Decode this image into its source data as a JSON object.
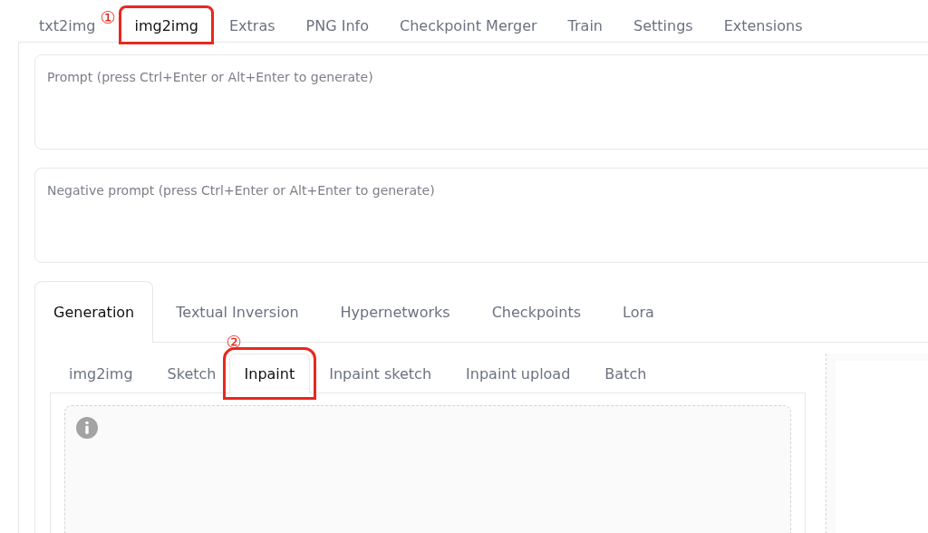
{
  "main_tabs": [
    {
      "label": "txt2img",
      "selected": false
    },
    {
      "label": "img2img",
      "selected": true,
      "callout": "①"
    },
    {
      "label": "Extras",
      "selected": false
    },
    {
      "label": "PNG Info",
      "selected": false
    },
    {
      "label": "Checkpoint Merger",
      "selected": false
    },
    {
      "label": "Train",
      "selected": false
    },
    {
      "label": "Settings",
      "selected": false
    },
    {
      "label": "Extensions",
      "selected": false
    }
  ],
  "prompt": {
    "placeholder": "Prompt (press Ctrl+Enter or Alt+Enter to generate)"
  },
  "negative_prompt": {
    "placeholder": "Negative prompt (press Ctrl+Enter or Alt+Enter to generate)"
  },
  "section_tabs": [
    {
      "label": "Generation",
      "selected": true
    },
    {
      "label": "Textual Inversion",
      "selected": false
    },
    {
      "label": "Hypernetworks",
      "selected": false
    },
    {
      "label": "Checkpoints",
      "selected": false
    },
    {
      "label": "Lora",
      "selected": false
    }
  ],
  "mode_tabs": [
    {
      "label": "img2img",
      "selected": false
    },
    {
      "label": "Sketch",
      "selected": false
    },
    {
      "label": "Inpaint",
      "selected": true,
      "callout": "②"
    },
    {
      "label": "Inpaint sketch",
      "selected": false
    },
    {
      "label": "Inpaint upload",
      "selected": false
    },
    {
      "label": "Batch",
      "selected": false
    }
  ]
}
